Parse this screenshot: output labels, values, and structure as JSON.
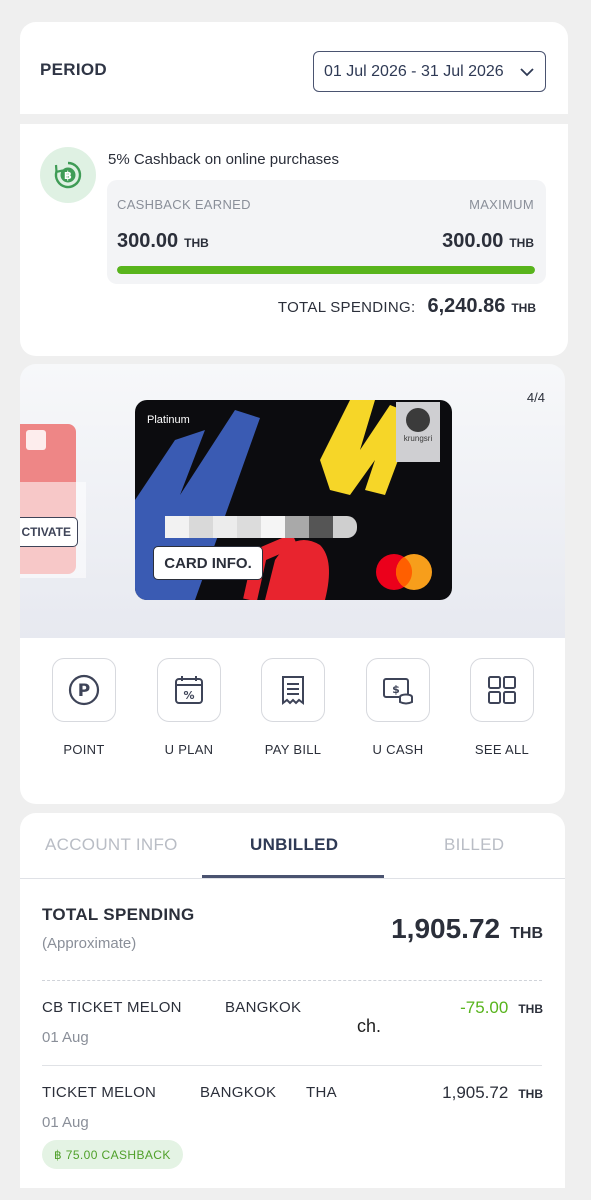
{
  "period": {
    "label": "PERIOD",
    "range": "01 Jul 2026 - 31 Jul 2026"
  },
  "cashback": {
    "title": "5% Cashback on online purchases",
    "earned_label": "CASHBACK EARNED",
    "max_label": "MAXIMUM",
    "earned_value": "300.00",
    "max_value": "300.00",
    "currency": "THB",
    "progress_fraction": 1.0,
    "total_spending_label": "TOTAL SPENDING:",
    "total_spending_value": "6,240.86",
    "icon": "baht-refresh-icon",
    "progress_color": "#58b41c"
  },
  "carousel": {
    "counter": "4/4",
    "prev_card_button": "CTIVATE",
    "card_tier": "Platinum",
    "bank_name": "krungsri",
    "card_info_button": "CARD INFO."
  },
  "actions": [
    {
      "label": "POINT",
      "icon": "point-icon"
    },
    {
      "label": "U PLAN",
      "icon": "calendar-percent-icon"
    },
    {
      "label": "PAY BILL",
      "icon": "receipt-icon"
    },
    {
      "label": "U CASH",
      "icon": "cash-icon"
    },
    {
      "label": "SEE ALL",
      "icon": "grid-icon"
    }
  ],
  "tabs": [
    {
      "label": "ACCOUNT INFO",
      "active": false
    },
    {
      "label": "UNBILLED",
      "active": true
    },
    {
      "label": "BILLED",
      "active": false
    }
  ],
  "summary": {
    "label": "TOTAL SPENDING",
    "sub": "(Approximate)",
    "value": "1,905.72",
    "currency": "THB"
  },
  "transactions": [
    {
      "merchant": "CB TICKET MELON",
      "city": "BANGKOK",
      "country": "",
      "date": "01 Aug",
      "amount": "-75.00",
      "currency": "THB",
      "credit": true
    },
    {
      "merchant": "TICKET MELON",
      "city": "BANGKOK",
      "country": "THA",
      "date": "01 Aug",
      "amount": "1,905.72",
      "currency": "THB",
      "credit": false,
      "cashback_chip": "฿ 75.00 CASHBACK"
    }
  ],
  "stray_text": "ch."
}
